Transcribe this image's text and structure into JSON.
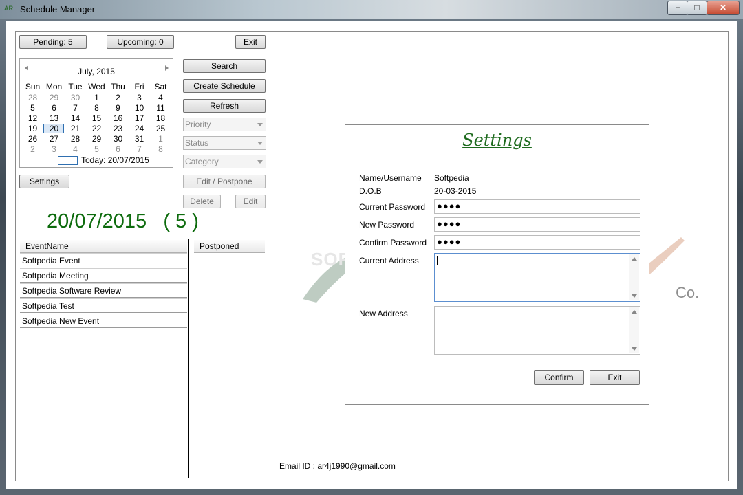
{
  "window": {
    "title": "Schedule Manager",
    "icon_text": "AR",
    "controls": {
      "minimize": "−",
      "maximize": "□",
      "close": "✕"
    }
  },
  "toolbar": {
    "pending": "Pending: 5",
    "upcoming": "Upcoming: 0",
    "exit": "Exit"
  },
  "calendar": {
    "month_label": "July, 2015",
    "weekdays": [
      "Sun",
      "Mon",
      "Tue",
      "Wed",
      "Thu",
      "Fri",
      "Sat"
    ],
    "weeks": [
      [
        "28",
        "29",
        "30",
        "1",
        "2",
        "3",
        "4"
      ],
      [
        "5",
        "6",
        "7",
        "8",
        "9",
        "10",
        "11"
      ],
      [
        "12",
        "13",
        "14",
        "15",
        "16",
        "17",
        "18"
      ],
      [
        "19",
        "20",
        "21",
        "22",
        "23",
        "24",
        "25"
      ],
      [
        "26",
        "27",
        "28",
        "29",
        "30",
        "31",
        "1"
      ],
      [
        "2",
        "3",
        "4",
        "5",
        "6",
        "7",
        "8"
      ]
    ],
    "selected": "20",
    "today_label": "Today: 20/07/2015"
  },
  "actions": {
    "search": "Search",
    "create_schedule": "Create Schedule",
    "refresh": "Refresh",
    "priority": "Priority",
    "status": "Status",
    "category": "Category",
    "edit_postpone": "Edit / Postpone",
    "delete": "Delete",
    "edit": "Edit",
    "settings": "Settings"
  },
  "date_heading": "20/07/2015   ( 5 )",
  "events": {
    "header": "EventName",
    "items": [
      "Softpedia Event",
      "Softpedia Meeting",
      "Softpedia Software Review",
      "Softpedia Test",
      "Softpedia New Event"
    ]
  },
  "postponed": {
    "header": "Postponed"
  },
  "settings": {
    "title": "Settings",
    "name_label": "Name/Username",
    "name_value": "Softpedia",
    "dob_label": "D.O.B",
    "dob_value": "20-03-2015",
    "current_password_label": "Current Password",
    "current_password": "●●●●",
    "new_password_label": "New Password",
    "new_password": "●●●●",
    "confirm_password_label": "Confirm Password",
    "confirm_password": "●●●●",
    "current_address_label": "Current Address",
    "new_address_label": "New Address",
    "confirm": "Confirm",
    "exit": "Exit"
  },
  "watermark": {
    "softpedia": "SOFTPEDIA",
    "co": "Co."
  },
  "footer": {
    "email": "Email ID : ar4j1990@gmail.com"
  },
  "colors": {
    "heading_green": "#0d6b0d",
    "settings_title": "#1d6a1d",
    "calendar_selection": "#2f6fb0"
  }
}
